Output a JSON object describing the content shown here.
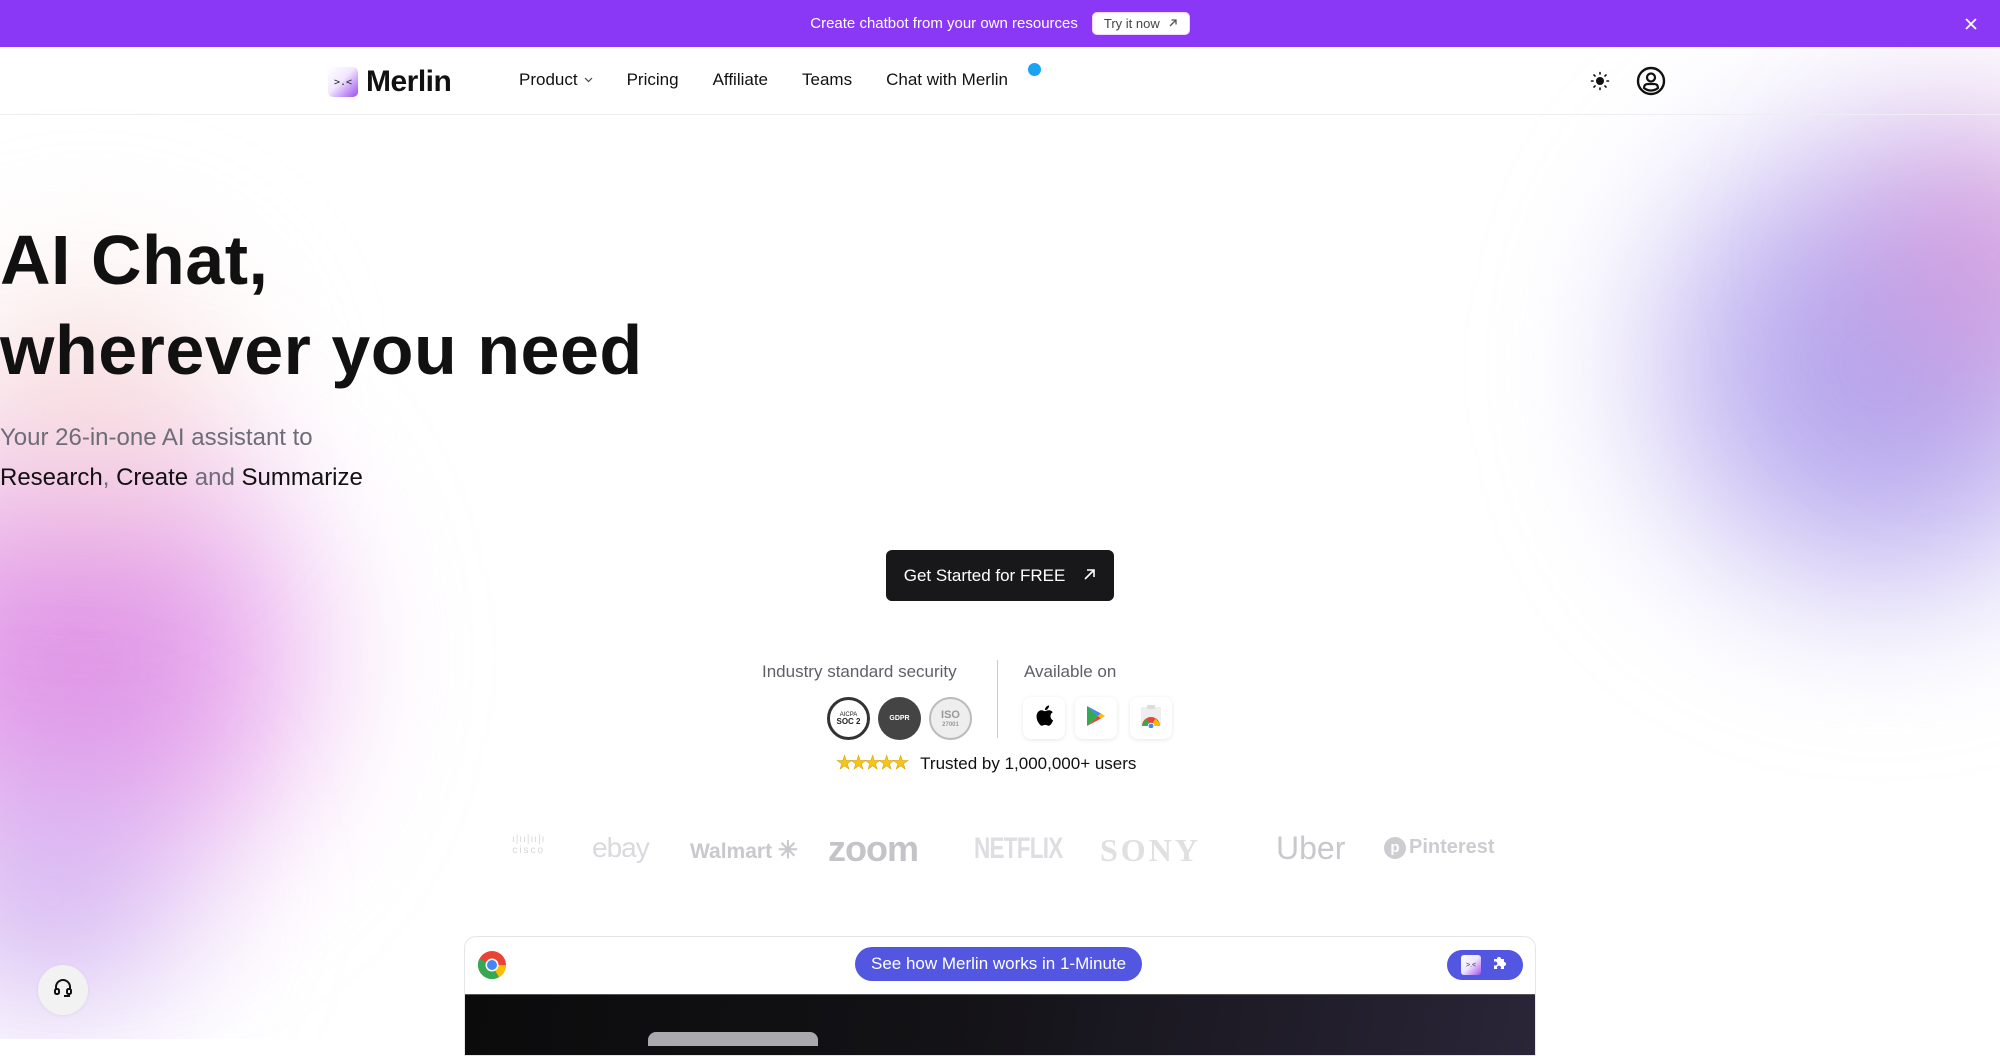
{
  "banner": {
    "text": "Create chatbot from your own resources",
    "button_label": "Try it now",
    "bg_color": "#8a38f5",
    "close_icon": "close-icon"
  },
  "nav": {
    "logo_text": "Merlin",
    "logo_face": ">.<",
    "items": [
      {
        "label": "Product",
        "has_dropdown": true
      },
      {
        "label": "Pricing"
      },
      {
        "label": "Affiliate"
      },
      {
        "label": "Teams"
      },
      {
        "label": "Chat with Merlin",
        "has_notification_dot": true
      }
    ],
    "theme_icon": "sun-icon",
    "account_icon": "user-circle-icon"
  },
  "hero": {
    "title_line1": "AI Chat,",
    "title_line2": "wherever you need",
    "subtitle_line1": "Your 26-in-one AI assistant to",
    "subtitle_words": {
      "w1": "Research",
      "sep1": ",",
      "w2": "Create",
      "and": "and",
      "w3": "Summarize"
    },
    "cta_label": "Get Started for FREE"
  },
  "security": {
    "title": "Industry standard security",
    "badges": [
      {
        "name": "AICPA SOC 2",
        "l1": "AICPA",
        "l2": "SOC 2"
      },
      {
        "name": "GDPR",
        "l1": "GDPR"
      },
      {
        "name": "ISO 27001",
        "l1": "ISO",
        "l2": "27001"
      }
    ]
  },
  "availability": {
    "title": "Available on",
    "platforms": [
      "App Store",
      "Google Play",
      "Chrome Web Store"
    ]
  },
  "trust": {
    "stars": 5,
    "stars_text": "★★★★★",
    "text": "Trusted by 1,000,000+ users"
  },
  "brands": [
    "cisco",
    "ebay",
    "Walmart",
    "zoom",
    "NETFLIX",
    "SONY",
    "Uber",
    "Pinterest"
  ],
  "video": {
    "button_label": "See how Merlin works in 1-Minute",
    "accent": "#5356e0"
  },
  "help": {
    "icon": "headset-icon"
  }
}
